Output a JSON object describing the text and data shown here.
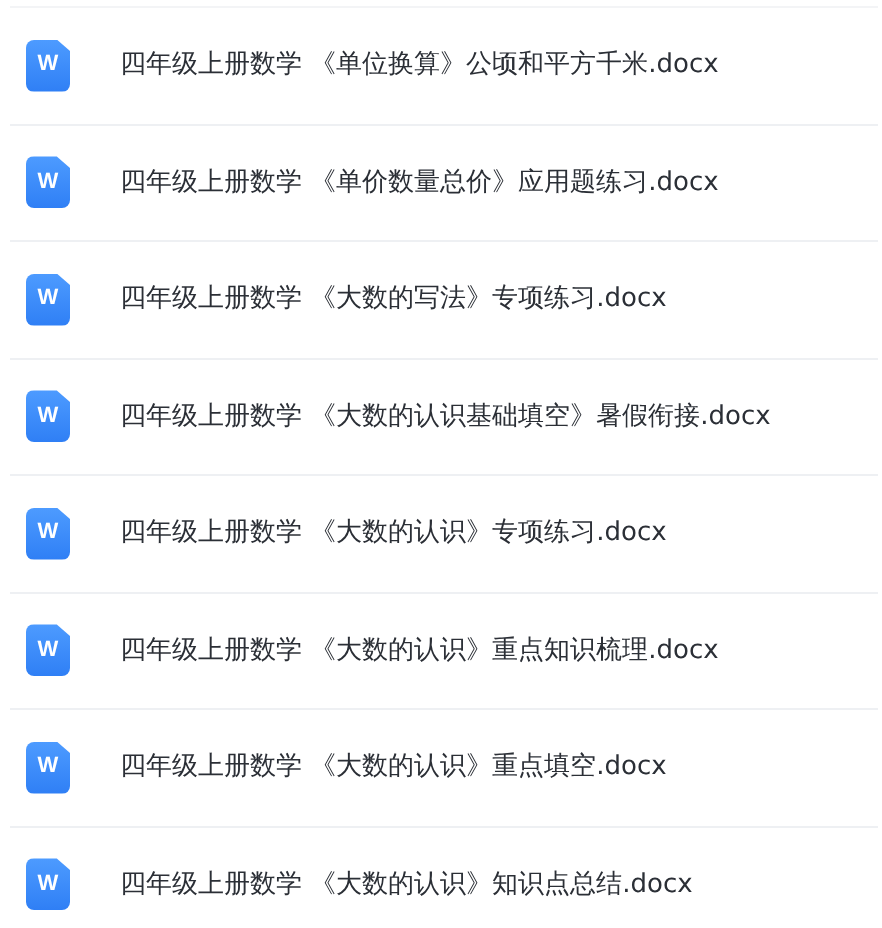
{
  "files": [
    {
      "icon_text": "W",
      "name": "四年级上册数学 《单位换算》公顷和平方千米.docx"
    },
    {
      "icon_text": "W",
      "name": "四年级上册数学 《单价数量总价》应用题练习.docx"
    },
    {
      "icon_text": "W",
      "name": "四年级上册数学 《大数的写法》专项练习.docx"
    },
    {
      "icon_text": "W",
      "name": "四年级上册数学 《大数的认识基础填空》暑假衔接.docx"
    },
    {
      "icon_text": "W",
      "name": "四年级上册数学 《大数的认识》专项练习.docx"
    },
    {
      "icon_text": "W",
      "name": "四年级上册数学 《大数的认识》重点知识梳理.docx"
    },
    {
      "icon_text": "W",
      "name": "四年级上册数学 《大数的认识》重点填空.docx"
    },
    {
      "icon_text": "W",
      "name": "四年级上册数学 《大数的认识》知识点总结.docx"
    }
  ]
}
